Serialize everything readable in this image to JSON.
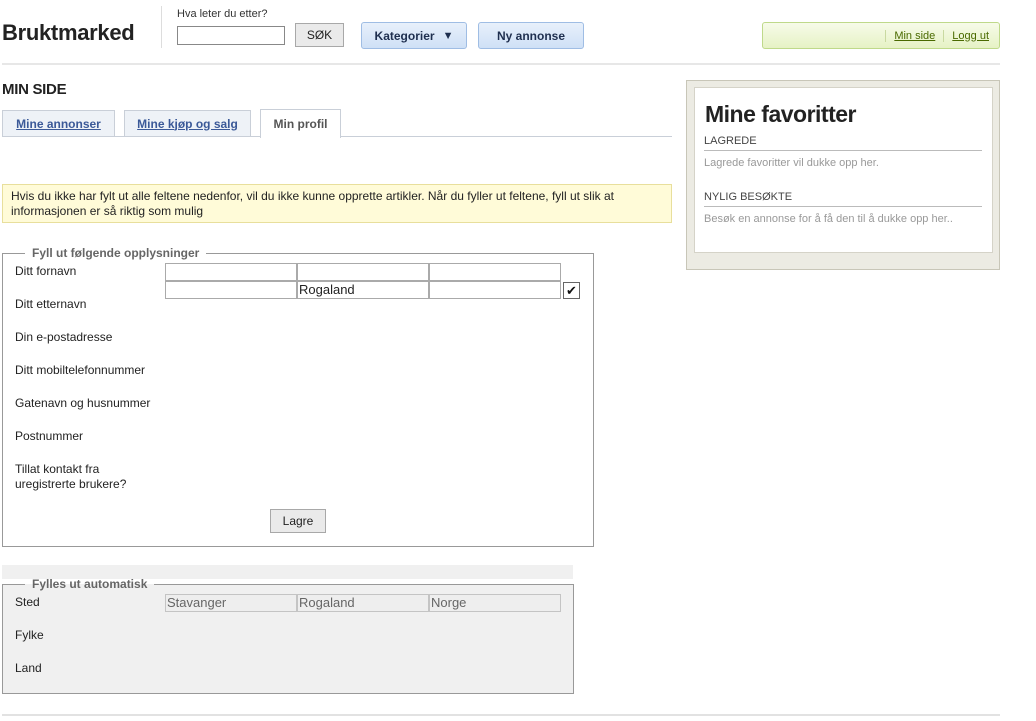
{
  "header": {
    "logo": "Bruktmarked",
    "search_label": "Hva leter du etter?",
    "search_value": "",
    "search_button": "SØK",
    "categories_button": "Kategorier",
    "new_ad_button": "Ny annonse",
    "my_page_link": "Min side",
    "logout_link": "Logg ut"
  },
  "page_title": "MIN SIDE",
  "tabs": [
    {
      "label": "Mine annonser",
      "active": false
    },
    {
      "label": "Mine kjøp og salg",
      "active": false
    },
    {
      "label": "Min profil",
      "active": true
    }
  ],
  "notice": "Hvis du ikke har fylt ut alle feltene nedenfor, vil du ikke kunne opprette artikler. Når du fyller ut feltene, fyll ut slik at informasjonen er så riktig som mulig",
  "profile_form": {
    "legend": "Fyll ut følgende opplysninger",
    "labels": [
      "Ditt fornavn",
      "Ditt etternavn",
      "Din e-postadresse",
      "Ditt mobiltelefonnummer",
      "Gatenavn og husnummer",
      "Postnummer",
      "Tillat kontakt fra uregistrerte brukere?"
    ],
    "row1": [
      "",
      "",
      ""
    ],
    "row2": [
      "",
      "Rogaland",
      ""
    ],
    "allow_contact": true,
    "save_button": "Lagre"
  },
  "auto_form": {
    "legend": "Fylles ut automatisk",
    "labels": [
      "Sted",
      "Fylke",
      "Land"
    ],
    "values": [
      "Stavanger",
      "Rogaland",
      "Norge"
    ]
  },
  "favorites": {
    "title": "Mine favoritter",
    "saved_heading": "LAGREDE",
    "saved_text": "Lagrede favoritter vil dukke opp her.",
    "recent_heading": "NYLIG BESØKTE",
    "recent_text": "Besøk en annonse for å få den til å dukke opp her.."
  }
}
